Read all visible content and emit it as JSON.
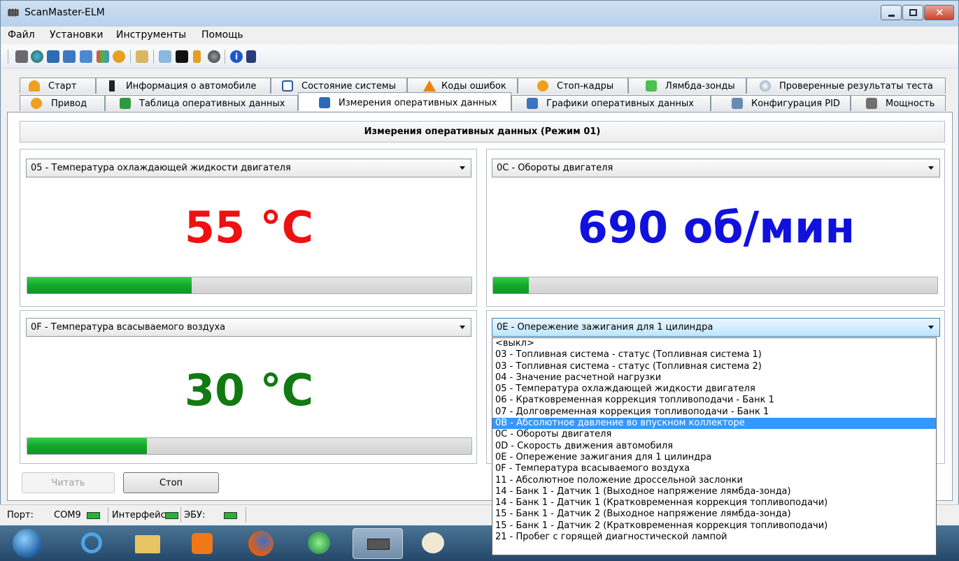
{
  "window": {
    "title": "ScanMaster-ELM"
  },
  "menu": [
    "Файл",
    "Установки",
    "Инструменты",
    "Помощь"
  ],
  "tabs_row1": [
    "Старт",
    "Информация о автомобиле",
    "Состояние системы",
    "Коды ошибок",
    "Стоп-кадры",
    "Лямбда-зонды",
    "Проверенные результаты теста"
  ],
  "tabs_row2": [
    "Привод",
    "Таблица оперативных данных",
    "Измерения оперативных данных",
    "Графики оперативных данных",
    "Конфигурация PID",
    "Мощность"
  ],
  "main": {
    "header": "Измерения оперативных данных (Режим 01)",
    "gauges": [
      {
        "pid": "05 - Температура охлаждающей жидкости двигателя",
        "value": "55 °C",
        "color": "#ee1111",
        "bar_fraction": 0.37
      },
      {
        "pid": "0C - Обороты двигателя",
        "value": "690 об/мин",
        "color": "#1111dd",
        "bar_fraction": 0.08
      },
      {
        "pid": "0F - Температура всасываемого воздуха",
        "value": "30 °C",
        "color": "#117a11",
        "bar_fraction": 0.27
      },
      {
        "pid": "0E - Опережение зажигания для 1 цилиндра",
        "value": "",
        "color": "#000000",
        "bar_fraction": 0
      }
    ],
    "read_button": "Читать",
    "stop_button": "Стоп"
  },
  "dropdown": {
    "selected_index": 7,
    "options": [
      "<выкл>",
      "03 - Топливная система - статус (Топливная система 1)",
      "03 - Топливная система - статус (Топливная система 2)",
      "04 - Значение расчетной нагрузки",
      "05 - Температура охлаждающей жидкости двигателя",
      "06 - Кратковременная коррекция топливоподачи - Банк 1",
      "07 - Долговременная коррекция топливоподачи - Банк 1",
      "0B - Абсолютное давление во впускном коллекторе",
      "0C - Обороты двигателя",
      "0D - Скорость движения автомобиля",
      "0E - Опережение зажигания для 1 цилиндра",
      "0F - Температура всасываемого воздуха",
      "11 - Абсолютное положение дроссельной заслонки",
      "14 - Банк 1 - Датчик 1 (Выходное напряжение лямбда-зонда)",
      "14 - Банк 1 - Датчик 1 (Кратковременная коррекция топливоподачи)",
      "15 - Банк 1 - Датчик 2 (Выходное напряжение лямбда-зонда)",
      "15 - Банк 1 - Датчик 2 (Кратковременная коррекция топливоподачи)",
      "21 - Пробег с горящей диагностической лампой"
    ]
  },
  "status": {
    "port_label": "Порт:",
    "port_value": "COM9",
    "interface_label": "Интерфейс",
    "ecu_label": "ЭБУ:"
  }
}
